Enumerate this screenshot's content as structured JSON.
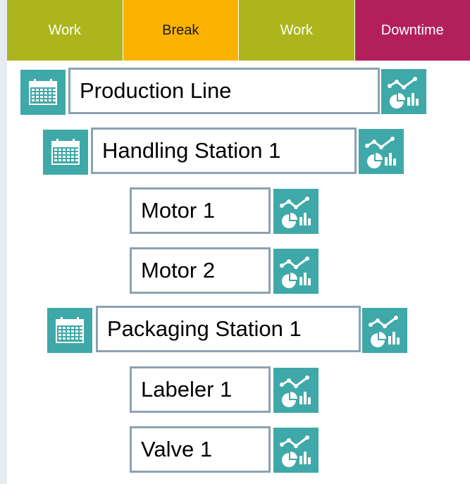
{
  "tabs": [
    {
      "label": "Work",
      "color": "#acb51b"
    },
    {
      "label": "Break",
      "color": "#fbb300"
    },
    {
      "label": "Work",
      "color": "#acb51b"
    },
    {
      "label": "Downtime",
      "color": "#b31f5b"
    }
  ],
  "icons": {
    "calendar": "calendar-icon",
    "analytics": "analytics-chart-icon",
    "accent": "#3fa8a8",
    "border": "#8ba2b3"
  },
  "nodes": [
    {
      "label": "Production Line",
      "level": 0,
      "has_calendar": true
    },
    {
      "label": "Handling Station 1",
      "level": 1,
      "has_calendar": true
    },
    {
      "label": "Motor 1",
      "level": 2,
      "has_calendar": false
    },
    {
      "label": "Motor 2",
      "level": 2,
      "has_calendar": false
    },
    {
      "label": "Packaging Station 1",
      "level": 1,
      "has_calendar": true
    },
    {
      "label": "Labeler 1",
      "level": 2,
      "has_calendar": false
    },
    {
      "label": "Valve 1",
      "level": 2,
      "has_calendar": false
    }
  ]
}
